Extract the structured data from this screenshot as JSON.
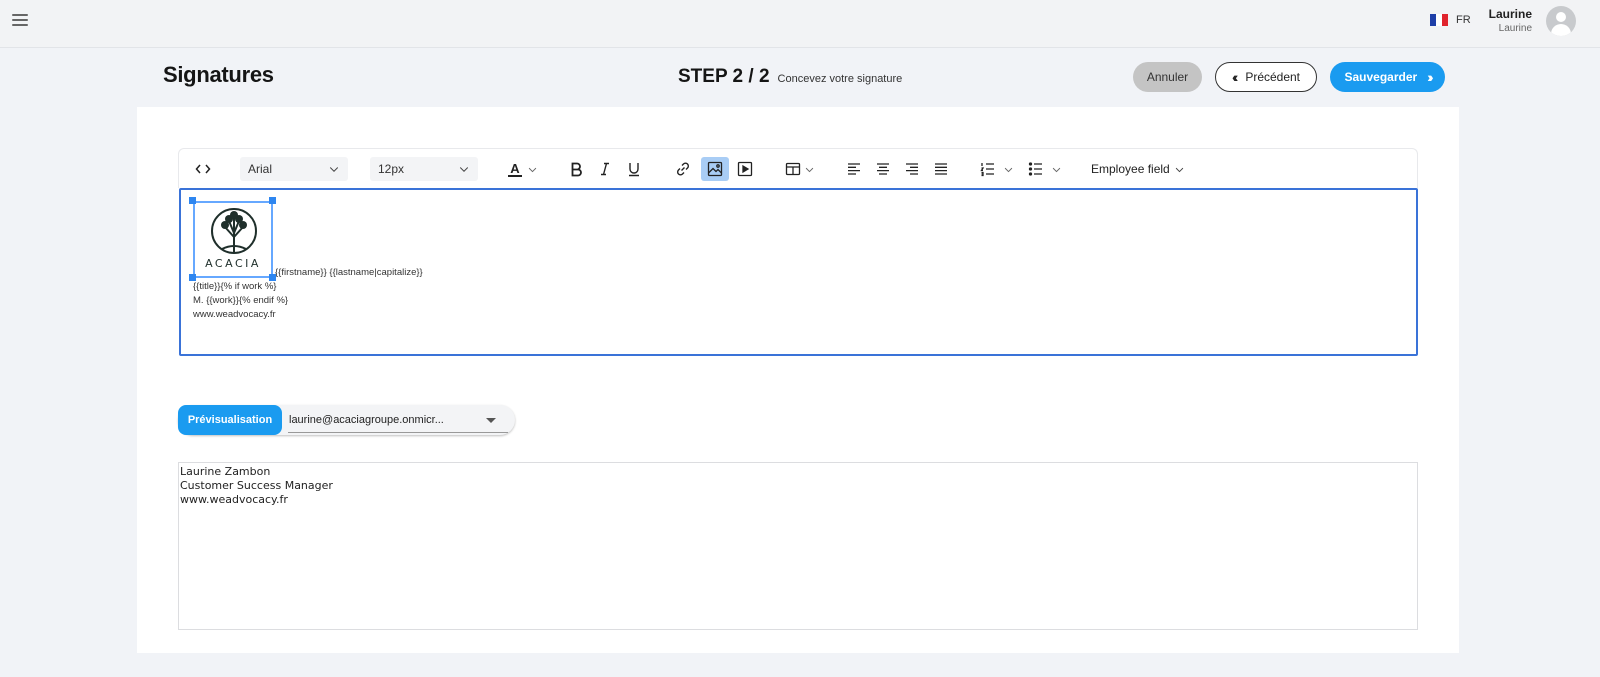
{
  "topbar": {
    "language": "FR",
    "user_name": "Laurine",
    "user_sub": "Laurine",
    "flag_colors": [
      "#1f3fa8",
      "#ffffff",
      "#e0232d"
    ]
  },
  "header": {
    "title": "Signatures",
    "step": "STEP 2 / 2",
    "step_desc": "Concevez votre signature",
    "cancel_label": "Annuler",
    "prev_label": "Précédent",
    "save_label": "Sauvegarder"
  },
  "toolbar": {
    "font_family": "Arial",
    "font_size": "12px",
    "text_color_label": "A",
    "employee_field_label": "Employee field",
    "icons": [
      "code-view-icon",
      "text-color-icon",
      "bold-icon",
      "italic-icon",
      "underline-icon",
      "link-icon",
      "image-icon",
      "video-icon",
      "table-icon",
      "align-left-icon",
      "align-center-icon",
      "align-right-icon",
      "align-justify-icon",
      "ordered-list-icon",
      "unordered-list-icon"
    ]
  },
  "editor": {
    "logo_text": "ACACIA",
    "line1": "{{firstname}} {{lastname|capitalize}}",
    "line2": "{{title}}{% if work %}",
    "line3": "M. {{work}}{% endif %}",
    "line4": "www.weadvocacy.fr"
  },
  "preview": {
    "button_label": "Prévisualisation",
    "selected_email": "laurine@acaciagroupe.onmicr...",
    "lines": [
      "Laurine Zambon",
      "Customer Success Manager",
      "www.weadvocacy.fr"
    ]
  },
  "colors": {
    "accent": "#1a9bf0",
    "editor_border": "#3a73d8",
    "active_tool": "#a9cdf5"
  }
}
